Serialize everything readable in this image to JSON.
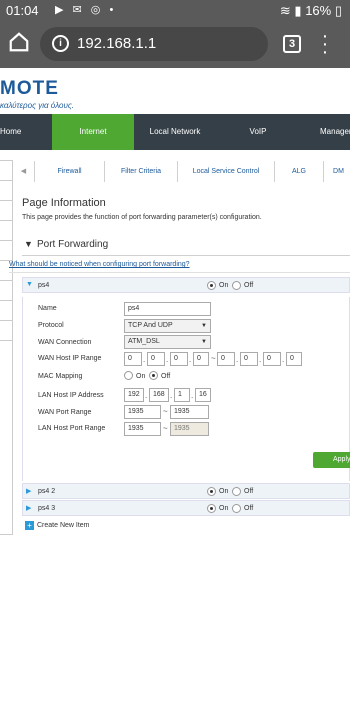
{
  "status_bar": {
    "time": "01:04",
    "battery": "16%"
  },
  "browser": {
    "url": "192.168.1.1",
    "tab_count": "3"
  },
  "brand": {
    "logo": "MOTE",
    "tagline": "καλύτερος για όλους."
  },
  "nav": {
    "items": [
      "Home",
      "Internet",
      "Local Network",
      "VoIP",
      "Managem"
    ]
  },
  "subtabs": {
    "arrow": "◀",
    "items": [
      "Firewall",
      "Filter Criteria",
      "Local Service Control",
      "ALG",
      "DM"
    ]
  },
  "page": {
    "title": "Page Information",
    "description": "This page provides the function of port forwarding parameter(s) configuration.",
    "section": "Port Forwarding",
    "notice_link": "What should be noticed when configuring port forwarding?"
  },
  "radio_labels": {
    "on": "On",
    "off": "Off"
  },
  "entries": [
    {
      "name": "ps4",
      "state": "on"
    },
    {
      "name": "ps4 2",
      "state": "on"
    },
    {
      "name": "ps4 3",
      "state": "on"
    }
  ],
  "form": {
    "name_label": "Name",
    "name_value": "ps4",
    "protocol_label": "Protocol",
    "protocol_value": "TCP And UDP",
    "wan_conn_label": "WAN Connection",
    "wan_conn_value": "ATM_DSL",
    "wan_ip_label": "WAN Host IP Range",
    "wan_ip_start": [
      "0",
      "0",
      "0",
      "0"
    ],
    "wan_ip_end": [
      "0",
      "0",
      "0",
      "0"
    ],
    "mac_label": "MAC Mapping",
    "mac_state": "off",
    "lan_ip_label": "LAN Host IP Address",
    "lan_ip": [
      "192",
      "168",
      "1",
      "16"
    ],
    "wan_port_label": "WAN Port Range",
    "wan_port_start": "1935",
    "wan_port_end": "1935",
    "lan_port_label": "LAN Host Port Range",
    "lan_port_start": "1935",
    "lan_port_end": "1935",
    "apply_label": "Apply"
  },
  "create_label": "Create New Item"
}
